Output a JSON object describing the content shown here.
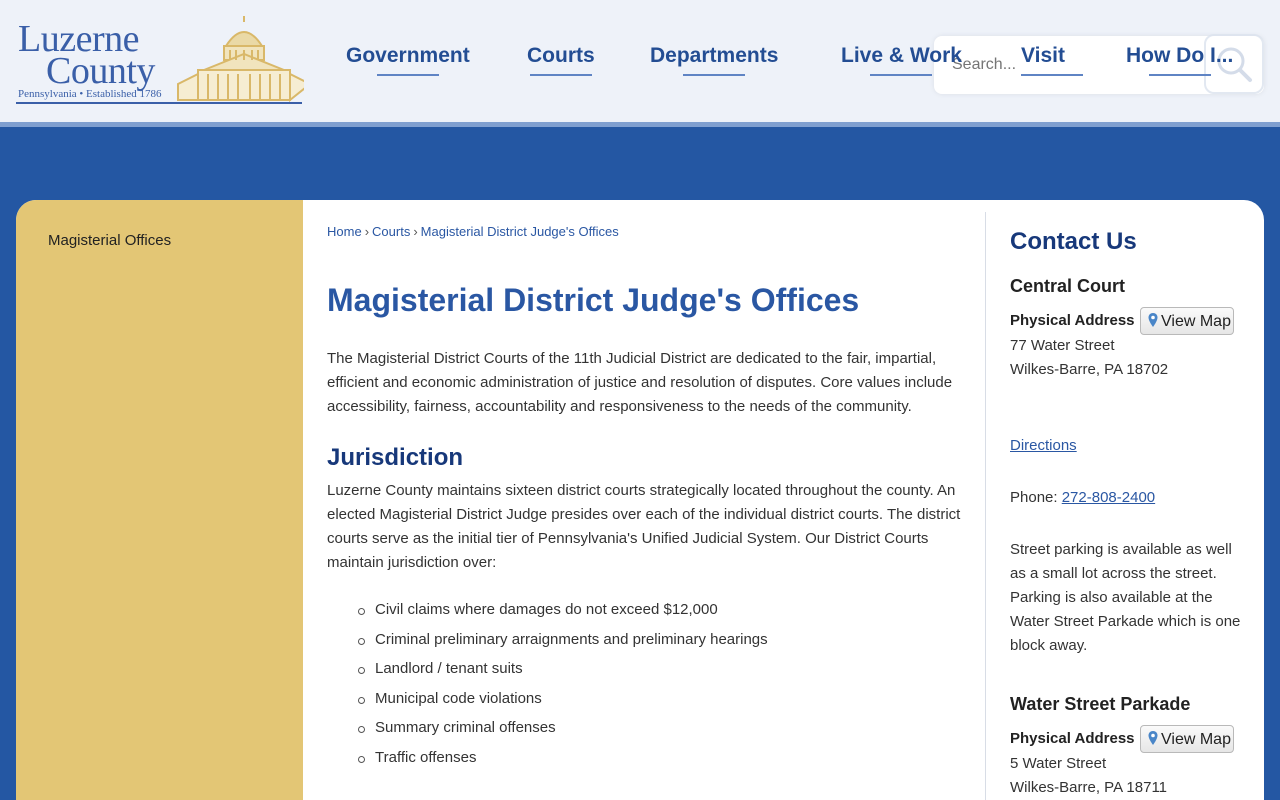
{
  "logo": {
    "line1": "Luzerne",
    "line2": "County",
    "tagline": "Pennsylvania • Established 1786"
  },
  "nav": {
    "items": [
      "Government",
      "Courts",
      "Departments",
      "Live & Work",
      "Visit",
      "How Do I..."
    ]
  },
  "search": {
    "placeholder": "Search..."
  },
  "sidebar": {
    "items": [
      "Magisterial Offices"
    ]
  },
  "breadcrumb": [
    "Home",
    "Courts",
    "Magisterial District Judge's Offices"
  ],
  "page": {
    "title": "Magisterial District Judge's Offices",
    "intro": "The Magisterial District Courts of the 11th Judicial District are dedicated to the fair, impartial, efficient and economic administration of justice and resolution of disputes. Core values include accessibility, fairness, accountability and responsiveness to the needs of the community.",
    "jurisdiction_heading": "Jurisdiction",
    "jurisdiction_text": "Luzerne County maintains sixteen district courts strategically located throughout the county. An elected Magisterial District Judge presides over each of the individual district courts. The district courts serve as the initial tier of Pennsylvania's Unified Judicial System. Our District Courts maintain jurisdiction over:",
    "jurisdiction_list": [
      "Civil claims where damages do not exceed $12,000",
      "Criminal preliminary arraignments and preliminary hearings",
      "Landlord / tenant suits",
      "Municipal code violations",
      "Summary criminal offenses",
      "Traffic offenses"
    ]
  },
  "contact": {
    "title": "Contact Us",
    "locations": [
      {
        "name": "Central Court",
        "address_label": "Physical Address",
        "map_button": "View Map",
        "street": "77 Water Street",
        "city": "Wilkes-Barre, PA 18702",
        "directions": "Directions",
        "phone_label": "Phone:",
        "phone": "272-808-2400",
        "note": "Street parking is available as well as a small lot across the street. Parking is also available at the Water Street Parkade which is one block away."
      },
      {
        "name": "Water Street Parkade",
        "address_label": "Physical Address",
        "map_button": "View Map",
        "street": "5 Water Street",
        "city": "Wilkes-Barre, PA 18711"
      }
    ]
  },
  "colors": {
    "brand_blue": "#2457a3",
    "sidebar_gold": "#e3c675",
    "heading_blue": "#2a57a3",
    "header_bg": "#eef2f9"
  }
}
